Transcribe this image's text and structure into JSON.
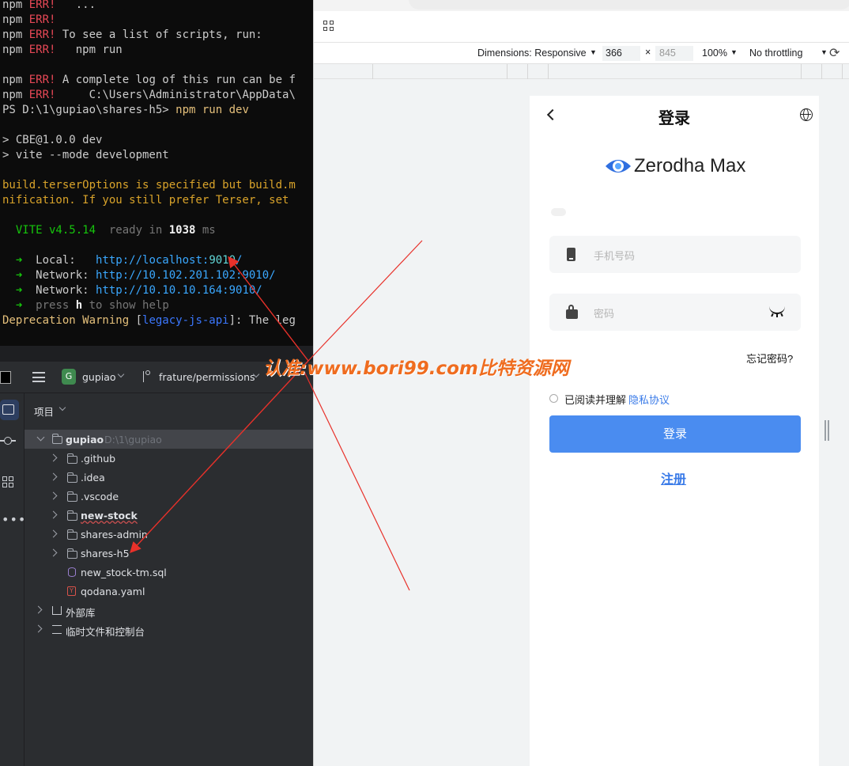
{
  "terminal": {
    "lines": [
      {
        "segments": [
          {
            "t": "npm ",
            "c": ""
          },
          {
            "t": "ERR!",
            "c": "c-red"
          },
          {
            "t": "   ...",
            "c": ""
          }
        ]
      },
      {
        "segments": [
          {
            "t": "npm ",
            "c": ""
          },
          {
            "t": "ERR!",
            "c": "c-red"
          }
        ]
      },
      {
        "segments": [
          {
            "t": "npm ",
            "c": ""
          },
          {
            "t": "ERR!",
            "c": "c-red"
          },
          {
            "t": " To see a list of scripts, run:",
            "c": ""
          }
        ]
      },
      {
        "segments": [
          {
            "t": "npm ",
            "c": ""
          },
          {
            "t": "ERR!",
            "c": "c-red"
          },
          {
            "t": "   npm run",
            "c": ""
          }
        ]
      },
      {
        "segments": []
      },
      {
        "segments": [
          {
            "t": "npm ",
            "c": ""
          },
          {
            "t": "ERR!",
            "c": "c-red"
          },
          {
            "t": " A complete log of this run can be f",
            "c": ""
          }
        ]
      },
      {
        "segments": [
          {
            "t": "npm ",
            "c": ""
          },
          {
            "t": "ERR!",
            "c": "c-red"
          },
          {
            "t": "     C:\\Users\\Administrator\\AppData\\",
            "c": ""
          }
        ]
      },
      {
        "segments": [
          {
            "t": "PS D:\\1\\gupiao\\shares-h5> ",
            "c": ""
          },
          {
            "t": "npm run dev",
            "c": "c-yellow"
          }
        ]
      },
      {
        "segments": []
      },
      {
        "segments": [
          {
            "t": "> CBE@1.0.0 dev",
            "c": ""
          }
        ]
      },
      {
        "segments": [
          {
            "t": "> vite --mode development",
            "c": ""
          }
        ]
      },
      {
        "segments": []
      },
      {
        "segments": [
          {
            "t": "build.terserOptions is specified but build.m",
            "c": "c-orange"
          }
        ]
      },
      {
        "segments": [
          {
            "t": "nification. If you still prefer Terser, set",
            "c": "c-orange"
          }
        ]
      },
      {
        "segments": []
      },
      {
        "segments": [
          {
            "t": "  VITE v4.5.14",
            "c": "c-green"
          },
          {
            "t": "  ready in ",
            "c": "c-gray"
          },
          {
            "t": "1038",
            "c": "c-white"
          },
          {
            "t": " ms",
            "c": "c-gray"
          }
        ]
      },
      {
        "segments": []
      },
      {
        "segments": [
          {
            "t": "  ➜  ",
            "c": "c-green"
          },
          {
            "t": "Local:   ",
            "c": ""
          },
          {
            "t": "http://localhost:",
            "c": "c-cyan"
          },
          {
            "t": "9010",
            "c": "c-teal"
          },
          {
            "t": "/",
            "c": "c-cyan"
          }
        ]
      },
      {
        "segments": [
          {
            "t": "  ➜  ",
            "c": "c-green"
          },
          {
            "t": "Network: ",
            "c": ""
          },
          {
            "t": "http://10.102.201.102:9010/",
            "c": "c-cyan"
          }
        ]
      },
      {
        "segments": [
          {
            "t": "  ➜  ",
            "c": "c-green"
          },
          {
            "t": "Network: ",
            "c": ""
          },
          {
            "t": "http://10.10.10.164:9010/",
            "c": "c-cyan"
          }
        ]
      },
      {
        "segments": [
          {
            "t": "  ➜  ",
            "c": "c-green"
          },
          {
            "t": "press ",
            "c": "c-gray"
          },
          {
            "t": "h",
            "c": "c-white"
          },
          {
            "t": " to show help",
            "c": "c-gray"
          }
        ]
      },
      {
        "segments": [
          {
            "t": "Deprecation Warning",
            "c": "c-yellow"
          },
          {
            "t": " [",
            "c": ""
          },
          {
            "t": "legacy-js-api",
            "c": "c-blue"
          },
          {
            "t": "]: The leg",
            "c": ""
          }
        ]
      }
    ]
  },
  "ide": {
    "project_badge": "G",
    "project_name": "gupiao",
    "branch": "frature/permissions",
    "panel_title": "项目",
    "root": {
      "name": "gupiao",
      "path": "D:\\1\\gupiao"
    },
    "tree": [
      {
        "label": ".github",
        "kind": "folder",
        "expandable": true
      },
      {
        "label": ".idea",
        "kind": "folder",
        "expandable": true
      },
      {
        "label": ".vscode",
        "kind": "folder",
        "expandable": true
      },
      {
        "label": "new-stock",
        "kind": "module",
        "expandable": true
      },
      {
        "label": "shares-admin",
        "kind": "folder",
        "expandable": true
      },
      {
        "label": "shares-h5",
        "kind": "folder",
        "expandable": true
      },
      {
        "label": "new_stock-tm.sql",
        "kind": "sql",
        "expandable": false
      },
      {
        "label": "qodana.yaml",
        "kind": "yaml",
        "expandable": false
      }
    ],
    "external_libs": "外部库",
    "scratches": "临时文件和控制台"
  },
  "browser": {
    "dimensions_label": "Dimensions: Responsive",
    "width_value": "366",
    "height_value": "845",
    "zoom": "100%",
    "throttling": "No throttling",
    "times_sign": "×"
  },
  "app": {
    "title": "登录",
    "logo_text": "Zerodha Max",
    "phone_placeholder": "手机号码",
    "password_placeholder": "密码",
    "forgot_password": "忘记密码?",
    "agree_text": "已阅读并理解",
    "privacy_link": "隐私协议",
    "login_button": "登录",
    "register_link": "注册",
    "accent_color": "#4a8cf0"
  },
  "watermark": "认准:www.bori99.com比特资源网"
}
